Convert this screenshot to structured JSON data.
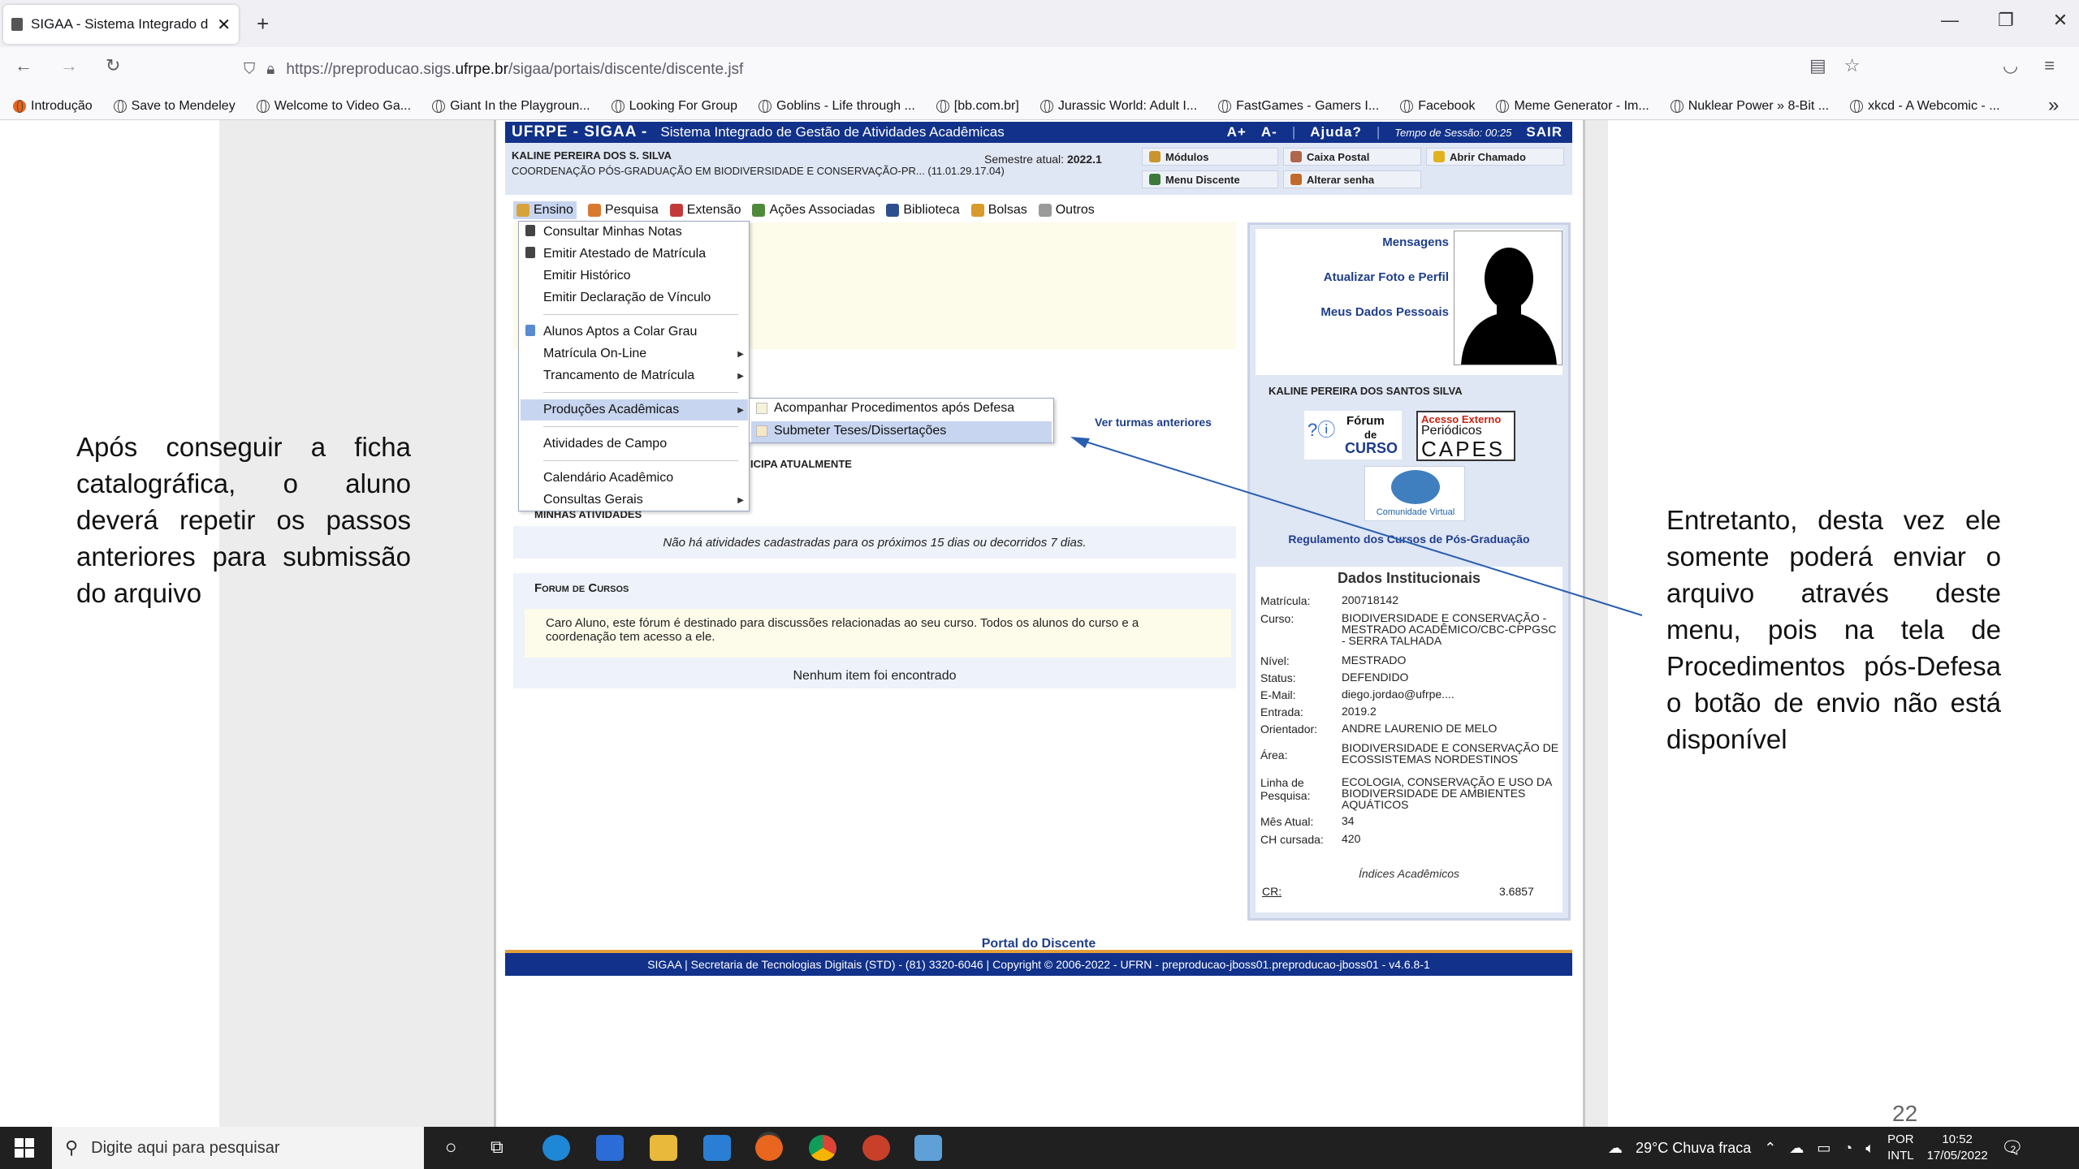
{
  "browser": {
    "tab_title": "SIGAA - Sistema Integrado de G",
    "new_tab": "+",
    "url_prefix": "https://preproducao.sigs.",
    "url_domain": "ufrpe.br",
    "url_suffix": "/sigaa/portais/discente/discente.jsf",
    "bookmarks": [
      "Introdução",
      "Save to Mendeley",
      "Welcome to Video Ga...",
      "Giant In the Playgroun...",
      "Looking For Group",
      "Goblins - Life through ...",
      "[bb.com.br]",
      "Jurassic World: Adult I...",
      "FastGames - Gamers I...",
      "Facebook",
      "Meme Generator - Im...",
      "Nuklear Power » 8-Bit ...",
      "xkcd - A Webcomic - ..."
    ],
    "more": "»"
  },
  "sigaa": {
    "brand": "UFRPE - SIGAA -",
    "system": "Sistema Integrado de Gestão de Atividades Acadêmicas",
    "font_up": "A+",
    "font_down": "A-",
    "help": "Ajuda?",
    "session_label": "Tempo de Sessão:",
    "session_time": "00:25",
    "logout": "SAIR",
    "user_name": "KALINE PEREIRA DOS S. SILVA",
    "user_coord": "COORDENAÇÃO PÓS-GRADUAÇÃO EM BIODIVERSIDADE E CONSERVAÇÃO-PR... (11.01.29.17.04)",
    "semester_label": "Semestre atual:",
    "semester": "2022.1",
    "quick": {
      "modulos": "Módulos",
      "caixa": "Caixa Postal",
      "chamado": "Abrir Chamado",
      "menu": "Menu Discente",
      "senha": "Alterar senha"
    },
    "menu": [
      "Ensino",
      "Pesquisa",
      "Extensão",
      "Ações Associadas",
      "Biblioteca",
      "Bolsas",
      "Outros"
    ],
    "ensino_items": [
      "Consultar Minhas Notas",
      "Emitir Atestado de Matrícula",
      "Emitir Histórico",
      "Emitir Declaração de Vínculo",
      "Alunos Aptos a Colar Grau",
      "Matrícula On-Line",
      "Trancamento de Matrícula",
      "Produções Acadêmicas",
      "Atividades de Campo",
      "Calendário Acadêmico",
      "Consultas Gerais"
    ],
    "producoes_items": [
      "Acompanhar Procedimentos após Defesa",
      "Submeter Teses/Dissertações"
    ],
    "ver_turmas": "Ver turmas anteriores",
    "participa": "ICIPA ATUALMENTE",
    "minhas_atividades": "Minhas atividades",
    "no_activities": "Não há atividades cadastradas para os próximos 15 dias ou decorridos 7 dias.",
    "forum_title": "Forum de Cursos",
    "forum_text": "Caro Aluno, este fórum é destinado para discussões relacionadas ao seu curso. Todos os alunos do curso e a coordenação tem acesso a ele.",
    "forum_empty": "Nenhum item foi encontrado",
    "side_links": [
      "Mensagens",
      "Atualizar Foto e Perfil",
      "Meus Dados Pessoais"
    ],
    "full_name": "KALINE PEREIRA DOS SANTOS SILVA",
    "forum_logo_top": "Fórum",
    "forum_logo_mid": "de",
    "forum_logo_bot": "CURSO",
    "capes_top": "Acesso Externo",
    "capes_mid": "Periódicos",
    "capes_bot": "CAPES",
    "comunidade": "Comunidade Virtual",
    "regulamento": "Regulamento dos Cursos de Pós-Graduação",
    "dados_title": "Dados Institucionais",
    "dados": [
      {
        "label": "Matrícula:",
        "value": "200718142"
      },
      {
        "label": "Curso:",
        "value": "BIODIVERSIDADE E CONSERVAÇÃO - MESTRADO ACADÊMICO/CBC-CPPGSC - SERRA TALHADA"
      },
      {
        "label": "Nível:",
        "value": "MESTRADO"
      },
      {
        "label": "Status:",
        "value": "DEFENDIDO"
      },
      {
        "label": "E-Mail:",
        "value": "diego.jordao@ufrpe...."
      },
      {
        "label": "Entrada:",
        "value": "2019.2"
      },
      {
        "label": "Orientador:",
        "value": "ANDRE LAURENIO DE MELO"
      },
      {
        "label": "Área:",
        "value": "BIODIVERSIDADE E CONSERVAÇÃO DE ECOSSISTEMAS NORDESTINOS"
      },
      {
        "label": "Linha de Pesquisa:",
        "value": "ECOLOGIA, CONSERVAÇÃO E USO DA BIODIVERSIDADE DE AMBIENTES AQUÁTICOS"
      },
      {
        "label": "Mês Atual:",
        "value": "34"
      },
      {
        "label": "CH cursada:",
        "value": "420"
      }
    ],
    "indices": "Índices Acadêmicos",
    "cr_label": "CR:",
    "cr_value": "3.6857",
    "portal_link": "Portal do Discente",
    "footer": "SIGAA | Secretaria de Tecnologias Digitais (STD) - (81) 3320-6046 | Copyright © 2006-2022 - UFRN - preproducao-jboss01.preproducao-jboss01 - v4.6.8-1"
  },
  "slide": {
    "left_text": "Após conseguir a ficha catalográfica, o aluno deverá repetir os passos anteriores para submissão do arquivo",
    "right_text": "Entretanto, desta vez ele somente poderá enviar o arquivo através deste menu, pois na tela de Procedimentos pós-Defesa o botão de envio não está disponível",
    "page_number": "22"
  },
  "taskbar": {
    "search_placeholder": "Digite aqui para pesquisar",
    "weather": "29°C  Chuva fraca",
    "lang1": "POR",
    "lang2": "INTL",
    "time": "10:52",
    "date": "17/05/2022",
    "notif_count": "2"
  },
  "colors": {
    "sigaa_blue": "#11318a",
    "highlight": "#c8d5f0",
    "arrow": "#2a5fb0"
  }
}
